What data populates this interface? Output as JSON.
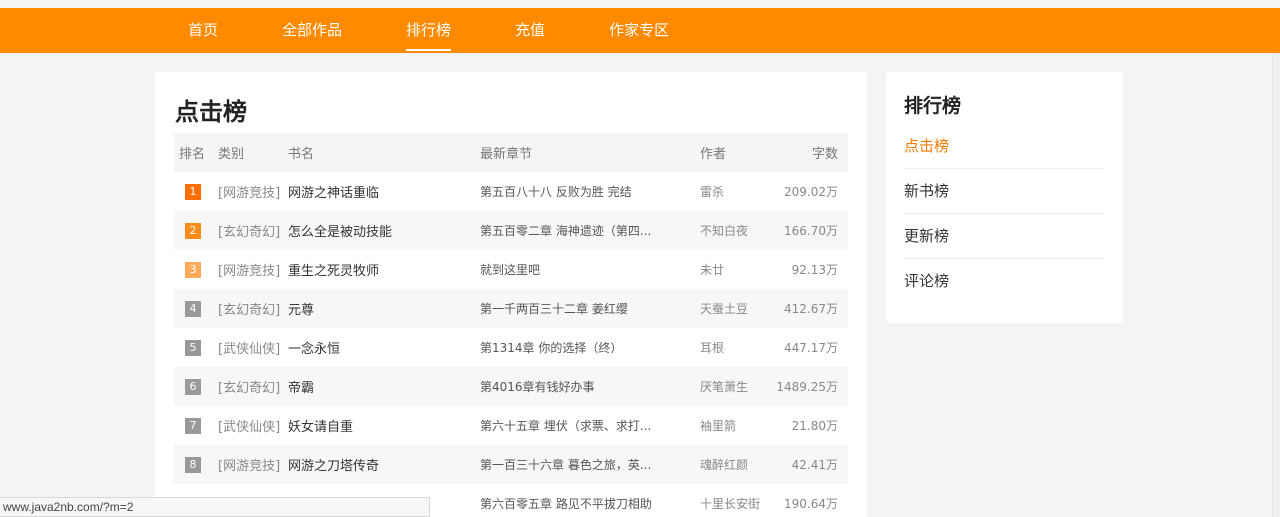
{
  "nav": {
    "items": [
      {
        "label": "首页"
      },
      {
        "label": "全部作品"
      },
      {
        "label": "排行榜"
      },
      {
        "label": "充值"
      },
      {
        "label": "作家专区"
      }
    ],
    "active_index": 2
  },
  "main": {
    "title": "点击榜",
    "columns": {
      "rank": "排名",
      "category": "类别",
      "book": "书名",
      "chapter": "最新章节",
      "author": "作者",
      "words": "字数"
    },
    "rows": [
      {
        "rank": "1",
        "category": "[网游竞技]",
        "book": "网游之神话重临",
        "chapter": "第五百八十八 反败为胜 完结",
        "author": "雷杀",
        "words": "209.02万"
      },
      {
        "rank": "2",
        "category": "[玄幻奇幻]",
        "book": "怎么全是被动技能",
        "chapter": "第五百零二章 海神遗迹（第四...",
        "author": "不知白夜",
        "words": "166.70万"
      },
      {
        "rank": "3",
        "category": "[网游竞技]",
        "book": "重生之死灵牧师",
        "chapter": "就到这里吧",
        "author": "未廿",
        "words": "92.13万"
      },
      {
        "rank": "4",
        "category": "[玄幻奇幻]",
        "book": "元尊",
        "chapter": "第一千两百三十二章 姜红缨",
        "author": "天蚕土豆",
        "words": "412.67万"
      },
      {
        "rank": "5",
        "category": "[武侠仙侠]",
        "book": "一念永恒",
        "chapter": "第1314章 你的选择（终）",
        "author": "耳根",
        "words": "447.17万"
      },
      {
        "rank": "6",
        "category": "[玄幻奇幻]",
        "book": "帝霸",
        "chapter": "第4016章有钱好办事",
        "author": "厌笔萧生",
        "words": "1489.25万"
      },
      {
        "rank": "7",
        "category": "[武侠仙侠]",
        "book": "妖女请自重",
        "chapter": "第六十五章 埋伏（求票、求打...",
        "author": "袖里箭",
        "words": "21.80万"
      },
      {
        "rank": "8",
        "category": "[网游竞技]",
        "book": "网游之刀塔传奇",
        "chapter": "第一百三十六章 暮色之旅，英...",
        "author": "魂醉红颜",
        "words": "42.41万"
      },
      {
        "rank": "",
        "category": "",
        "book": "",
        "chapter": "第六百零五章 路见不平拔刀相助",
        "author": "十里长安街",
        "words": "190.64万"
      }
    ]
  },
  "side": {
    "title": "排行榜",
    "items": [
      {
        "label": "点击榜"
      },
      {
        "label": "新书榜"
      },
      {
        "label": "更新榜"
      },
      {
        "label": "评论榜"
      }
    ],
    "active_index": 0
  },
  "status_url": "www.java2nb.com/?m=2",
  "colors": {
    "brand": "#ff8a00",
    "active_link": "#ff7a00",
    "rank1": "#ff6e00",
    "rank2": "#ff8c1a",
    "rank3": "#ffab5a",
    "rank_other": "#999999"
  }
}
